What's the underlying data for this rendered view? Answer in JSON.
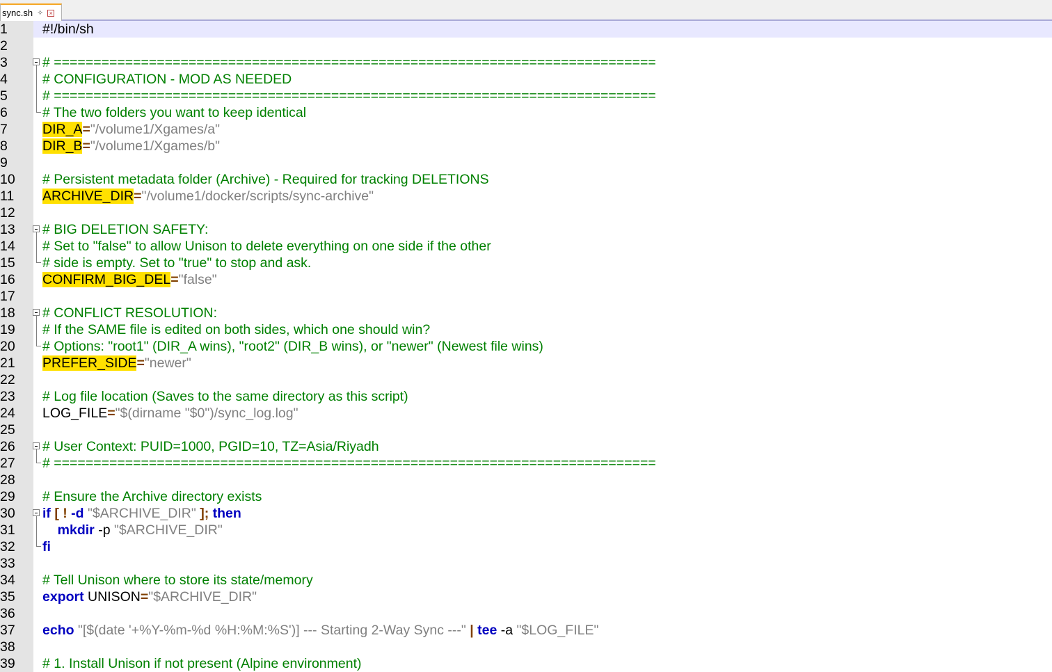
{
  "tab": {
    "filename": "sync.sh",
    "pin_icon": "pin-icon",
    "close_icon": "close-icon"
  },
  "lines": [
    {
      "n": "1",
      "current": true,
      "fold": "",
      "tokens": [
        {
          "t": "txt",
          "v": "#!/bin/sh"
        }
      ]
    },
    {
      "n": "2",
      "fold": "",
      "tokens": []
    },
    {
      "n": "3",
      "fold": "start",
      "tokens": [
        {
          "t": "cm",
          "v": "# ============================================================================"
        }
      ]
    },
    {
      "n": "4",
      "fold": "mid",
      "tokens": [
        {
          "t": "cm",
          "v": "# CONFIGURATION - MOD AS NEEDED"
        }
      ]
    },
    {
      "n": "5",
      "fold": "mid",
      "tokens": [
        {
          "t": "cm",
          "v": "# ============================================================================"
        }
      ]
    },
    {
      "n": "6",
      "fold": "end",
      "tokens": [
        {
          "t": "cm",
          "v": "# The two folders you want to keep identical"
        }
      ]
    },
    {
      "n": "7",
      "fold": "",
      "tokens": [
        {
          "t": "hl",
          "v": "DIR_A"
        },
        {
          "t": "op",
          "v": "="
        },
        {
          "t": "str",
          "v": "\"/volume1/Xgames/a\""
        }
      ]
    },
    {
      "n": "8",
      "fold": "",
      "tokens": [
        {
          "t": "hl",
          "v": "DIR_B"
        },
        {
          "t": "op",
          "v": "="
        },
        {
          "t": "str",
          "v": "\"/volume1/Xgames/b\""
        }
      ]
    },
    {
      "n": "9",
      "fold": "",
      "tokens": []
    },
    {
      "n": "10",
      "fold": "",
      "tokens": [
        {
          "t": "cm",
          "v": "# Persistent metadata folder (Archive) - Required for tracking DELETIONS"
        }
      ]
    },
    {
      "n": "11",
      "fold": "",
      "tokens": [
        {
          "t": "hl",
          "v": "ARCHIVE_DIR"
        },
        {
          "t": "op",
          "v": "="
        },
        {
          "t": "str",
          "v": "\"/volume1/docker/scripts/sync-archive\""
        }
      ]
    },
    {
      "n": "12",
      "fold": "",
      "tokens": []
    },
    {
      "n": "13",
      "fold": "start",
      "tokens": [
        {
          "t": "cm",
          "v": "# BIG DELETION SAFETY:"
        }
      ]
    },
    {
      "n": "14",
      "fold": "mid",
      "tokens": [
        {
          "t": "cm",
          "v": "# Set to \"false\" to allow Unison to delete everything on one side if the other"
        }
      ]
    },
    {
      "n": "15",
      "fold": "end",
      "tokens": [
        {
          "t": "cm",
          "v": "# side is empty. Set to \"true\" to stop and ask."
        }
      ]
    },
    {
      "n": "16",
      "fold": "",
      "tokens": [
        {
          "t": "hl",
          "v": "CONFIRM_BIG_DEL"
        },
        {
          "t": "op",
          "v": "="
        },
        {
          "t": "str",
          "v": "\"false\""
        }
      ]
    },
    {
      "n": "17",
      "fold": "",
      "tokens": []
    },
    {
      "n": "18",
      "fold": "start",
      "tokens": [
        {
          "t": "cm",
          "v": "# CONFLICT RESOLUTION:"
        }
      ]
    },
    {
      "n": "19",
      "fold": "mid",
      "tokens": [
        {
          "t": "cm",
          "v": "# If the SAME file is edited on both sides, which one should win?"
        }
      ]
    },
    {
      "n": "20",
      "fold": "end",
      "tokens": [
        {
          "t": "cm",
          "v": "# Options: \"root1\" (DIR_A wins), \"root2\" (DIR_B wins), or \"newer\" (Newest file wins)"
        }
      ]
    },
    {
      "n": "21",
      "fold": "",
      "tokens": [
        {
          "t": "hl",
          "v": "PREFER_SIDE"
        },
        {
          "t": "op",
          "v": "="
        },
        {
          "t": "str",
          "v": "\"newer\""
        }
      ]
    },
    {
      "n": "22",
      "fold": "",
      "tokens": []
    },
    {
      "n": "23",
      "fold": "",
      "tokens": [
        {
          "t": "cm",
          "v": "# Log file location (Saves to the same directory as this script)"
        }
      ]
    },
    {
      "n": "24",
      "fold": "",
      "tokens": [
        {
          "t": "txt",
          "v": "LOG_FILE"
        },
        {
          "t": "op",
          "v": "="
        },
        {
          "t": "str",
          "v": "\"$(dirname \"$0\")/sync_log.log\""
        }
      ]
    },
    {
      "n": "25",
      "fold": "",
      "tokens": []
    },
    {
      "n": "26",
      "fold": "start",
      "tokens": [
        {
          "t": "cm",
          "v": "# User Context: PUID=1000, PGID=10, TZ=Asia/Riyadh"
        }
      ]
    },
    {
      "n": "27",
      "fold": "end",
      "tokens": [
        {
          "t": "cm",
          "v": "# ============================================================================"
        }
      ]
    },
    {
      "n": "28",
      "fold": "",
      "tokens": []
    },
    {
      "n": "29",
      "fold": "",
      "tokens": [
        {
          "t": "cm",
          "v": "# Ensure the Archive directory exists"
        }
      ]
    },
    {
      "n": "30",
      "fold": "start",
      "tokens": [
        {
          "t": "kw",
          "v": "if"
        },
        {
          "t": "txt",
          "v": " "
        },
        {
          "t": "op",
          "v": "[ !"
        },
        {
          "t": "txt",
          "v": " "
        },
        {
          "t": "kw",
          "v": "-d"
        },
        {
          "t": "txt",
          "v": " "
        },
        {
          "t": "str",
          "v": "\"$ARCHIVE_DIR\""
        },
        {
          "t": "txt",
          "v": " "
        },
        {
          "t": "op",
          "v": "];"
        },
        {
          "t": "txt",
          "v": " "
        },
        {
          "t": "kw",
          "v": "then"
        }
      ]
    },
    {
      "n": "31",
      "fold": "mid",
      "tokens": [
        {
          "t": "txt",
          "v": "    "
        },
        {
          "t": "kw",
          "v": "mkdir"
        },
        {
          "t": "txt",
          "v": " -p "
        },
        {
          "t": "str",
          "v": "\"$ARCHIVE_DIR\""
        }
      ]
    },
    {
      "n": "32",
      "fold": "end",
      "tokens": [
        {
          "t": "kw",
          "v": "fi"
        }
      ]
    },
    {
      "n": "33",
      "fold": "",
      "tokens": []
    },
    {
      "n": "34",
      "fold": "",
      "tokens": [
        {
          "t": "cm",
          "v": "# Tell Unison where to store its state/memory"
        }
      ]
    },
    {
      "n": "35",
      "fold": "",
      "tokens": [
        {
          "t": "kw",
          "v": "export"
        },
        {
          "t": "txt",
          "v": " UNISON"
        },
        {
          "t": "op",
          "v": "="
        },
        {
          "t": "str",
          "v": "\"$ARCHIVE_DIR\""
        }
      ]
    },
    {
      "n": "36",
      "fold": "",
      "tokens": []
    },
    {
      "n": "37",
      "fold": "",
      "tokens": [
        {
          "t": "kw",
          "v": "echo"
        },
        {
          "t": "txt",
          "v": " "
        },
        {
          "t": "str",
          "v": "\"[$(date '+%Y-%m-%d %H:%M:%S')] --- Starting 2-Way Sync ---\""
        },
        {
          "t": "txt",
          "v": " "
        },
        {
          "t": "op",
          "v": "|"
        },
        {
          "t": "txt",
          "v": " "
        },
        {
          "t": "kw",
          "v": "tee"
        },
        {
          "t": "txt",
          "v": " -a "
        },
        {
          "t": "str",
          "v": "\"$LOG_FILE\""
        }
      ]
    },
    {
      "n": "38",
      "fold": "",
      "tokens": []
    },
    {
      "n": "39",
      "fold": "",
      "tokens": [
        {
          "t": "cm",
          "v": "# 1. Install Unison if not present (Alpine environment)"
        }
      ]
    }
  ]
}
